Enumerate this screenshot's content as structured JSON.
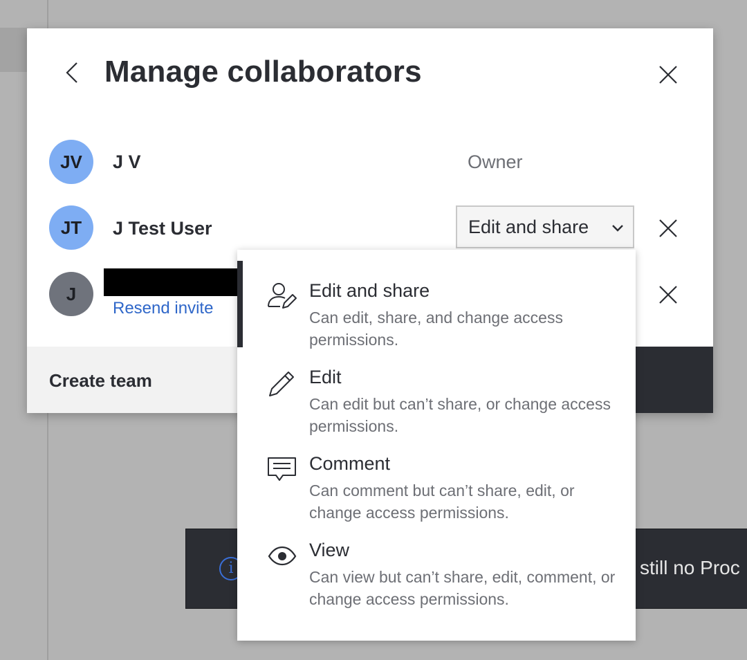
{
  "dialog": {
    "title": "Manage collaborators"
  },
  "collaborators": [
    {
      "initials": "JV",
      "name": "J V",
      "role": "Owner",
      "avatar_color": "#7eadf3"
    },
    {
      "initials": "JT",
      "name": "J Test User",
      "permission": "Edit and share",
      "avatar_color": "#7eadf3"
    },
    {
      "initials": "J",
      "name": "",
      "action": "Resend invite",
      "avatar_color": "#6f737c"
    }
  ],
  "footer": {
    "create_team": "Create team"
  },
  "permission_menu": {
    "selected_index": 0,
    "options": [
      {
        "title": "Edit and share",
        "description": "Can edit, share, and change access permissions.",
        "icon": "user-edit-icon"
      },
      {
        "title": "Edit",
        "description": "Can edit but can’t share, or change access permissions.",
        "icon": "pencil-icon"
      },
      {
        "title": "Comment",
        "description": "Can comment but can’t share, edit, or change access permissions.",
        "icon": "comment-icon"
      },
      {
        "title": "View",
        "description": "Can view but can’t share, edit, comment, or change access permissions.",
        "icon": "eye-icon"
      }
    ]
  },
  "toast": {
    "text": "still no Proc",
    "icon_glyph": "i"
  },
  "colors": {
    "accent_link": "#2f67c9",
    "dark": "#2b2d33",
    "avatar_blue": "#7eadf3",
    "avatar_gray": "#6f737c"
  }
}
